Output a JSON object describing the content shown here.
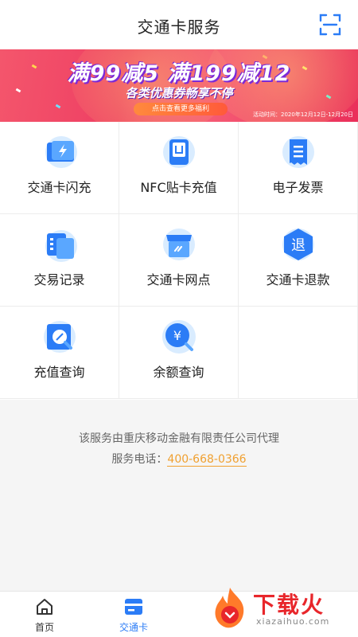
{
  "header": {
    "title": "交通卡服务",
    "scan_icon": "scan-icon"
  },
  "banner": {
    "headline": "满99减5 满199减12",
    "sub": "各类优惠券畅享不停",
    "cta": "点击查看更多福利",
    "date": "活动时间：2020年12月12日-12月20日"
  },
  "services": [
    {
      "label": "交通卡闪充",
      "icon": "flash-charge-icon"
    },
    {
      "label": "NFC贴卡充值",
      "icon": "nfc-card-icon"
    },
    {
      "label": "电子发票",
      "icon": "invoice-icon"
    },
    {
      "label": "交易记录",
      "icon": "transaction-record-icon"
    },
    {
      "label": "交通卡网点",
      "icon": "store-icon"
    },
    {
      "label": "交通卡退款",
      "icon": "refund-icon"
    },
    {
      "label": "充值查询",
      "icon": "recharge-query-icon"
    },
    {
      "label": "余额查询",
      "icon": "balance-query-icon"
    }
  ],
  "info": {
    "line1": "该服务由重庆移动金融有限责任公司代理",
    "phone_label": "服务电话：",
    "phone": "400-668-0366"
  },
  "nav": {
    "items": [
      {
        "label": "首页",
        "icon": "home-icon"
      },
      {
        "label": "交通卡",
        "icon": "card-icon"
      }
    ],
    "active_color": "#2b7cf6"
  },
  "watermark": {
    "text": "下载火",
    "sub": "xiazaihuo.com"
  },
  "colors": {
    "accent": "#2b7cf6",
    "icon_light": "#8ec8ff",
    "phone": "#f0a030",
    "banner": "#ee3f63"
  }
}
